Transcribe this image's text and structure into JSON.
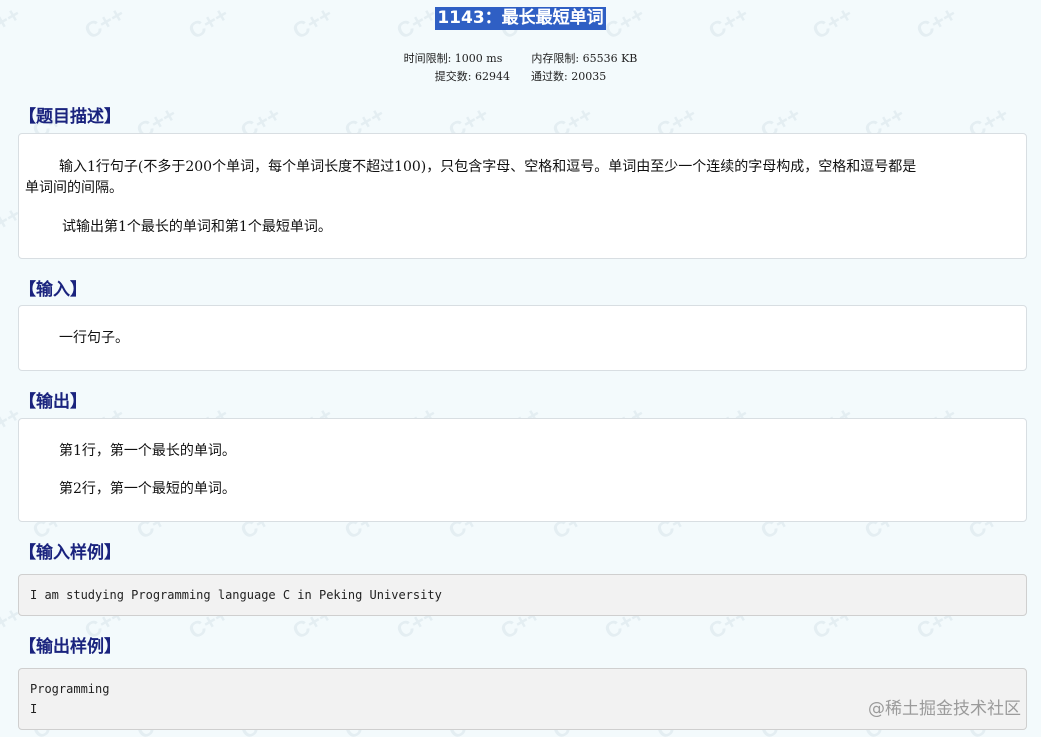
{
  "problem": {
    "title": "1143：最长最短单词",
    "time_limit": "时间限制: 1000 ms",
    "memory_limit": "内存限制: 65536 KB",
    "submissions": "提交数: 62944",
    "accepted": "通过数: 20035"
  },
  "description": {
    "heading": "【题目描述】",
    "line1": "输入1行句子(不多于200个单词，每个单词长度不超过100)，只包含字母、空格和逗号。单词由至少一个连续的字母构成，空格和逗号都是",
    "line2": "单词间的间隔。",
    "line3": "试输出第1个最长的单词和第1个最短单词。"
  },
  "input": {
    "heading": "【输入】",
    "text": "一行句子。"
  },
  "output": {
    "heading": "【输出】",
    "line1": "第1行，第一个最长的单词。",
    "line2": "第2行，第一个最短的单词。"
  },
  "sample_input": {
    "heading": "【输入样例】",
    "line1": "I am studying Programming language C in Peking University"
  },
  "sample_output": {
    "heading": "【输出样例】",
    "line1": "Programming",
    "line2": "I"
  },
  "brand": "@稀土掘金技术社区"
}
